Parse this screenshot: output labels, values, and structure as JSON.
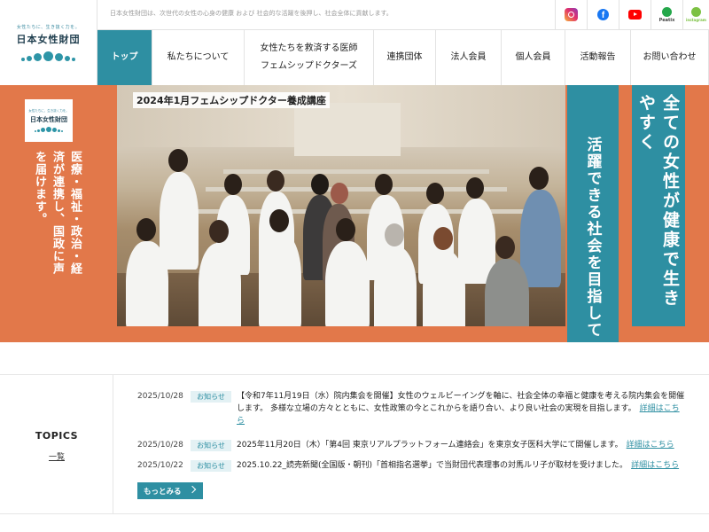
{
  "header": {
    "logo": {
      "tagline": "女性たちに、生き抜く力を。",
      "name": "日本女性財団"
    },
    "tagline": "日本女性財団は、次世代の女性の心身の健康 および 社会的な活躍を後押し、社会全体に貢献します。",
    "sns": [
      {
        "icon": "instagram-icon"
      },
      {
        "icon": "facebook-icon",
        "glyph": "f"
      },
      {
        "icon": "youtube-icon"
      },
      {
        "icon": "peatix-icon",
        "label": "Peatix"
      },
      {
        "icon": "instagram-highlight-icon",
        "label": "instagram"
      }
    ],
    "nav": [
      {
        "label": "トップ",
        "active": true
      },
      {
        "label": "私たちについて"
      },
      {
        "label_line1": "女性たちを救済する医師",
        "label_line2": "フェムシップドクターズ"
      },
      {
        "label": "連携団体"
      },
      {
        "label": "法人会員"
      },
      {
        "label": "個人会員"
      },
      {
        "label": "活動報告"
      },
      {
        "label": "お問い合わせ"
      }
    ]
  },
  "hero": {
    "badge": {
      "tagline": "女性たちに、生き抜く力を。",
      "name": "日本女性財団"
    },
    "left_text": "医療・福祉・政治・経済が連携し、国政に声を届けます。",
    "photo_caption": "2024年1月フェムシップドクター養成講座",
    "banner_inner": "活躍できる社会を目指して",
    "banner_outer": "全ての女性が健康で生きやすく",
    "colors": {
      "orange": "#e2784a",
      "teal": "#2e8fa2"
    }
  },
  "topics": {
    "title": "TOPICS",
    "all_link": "一覧",
    "more_button": "もっとみる",
    "items": [
      {
        "date": "2025/10/28",
        "category": "お知らせ",
        "text": "【令和7年11月19日（水）院内集会を開催】女性のウェルビーイングを軸に、社会全体の幸福と健康を考える院内集会を開催します。 多様な立場の方々とともに、女性政策の今とこれからを語り合い、より良い社会の実現を目指します。",
        "link": "詳細はこちら"
      },
      {
        "date": "2025/10/28",
        "category": "お知らせ",
        "text": "2025年11月20日（木）「第4回 東京リアルプラットフォーム連絡会」を東京女子医科大学にて開催します。",
        "link": "詳細はこちら"
      },
      {
        "date": "2025/10/22",
        "category": "お知らせ",
        "text": "2025.10.22_読売新聞(全国版・朝刊)「首相指名選挙」で当財団代表理事の対馬ルリ子が取材を受けました。",
        "link": "詳細はこちら"
      }
    ]
  }
}
